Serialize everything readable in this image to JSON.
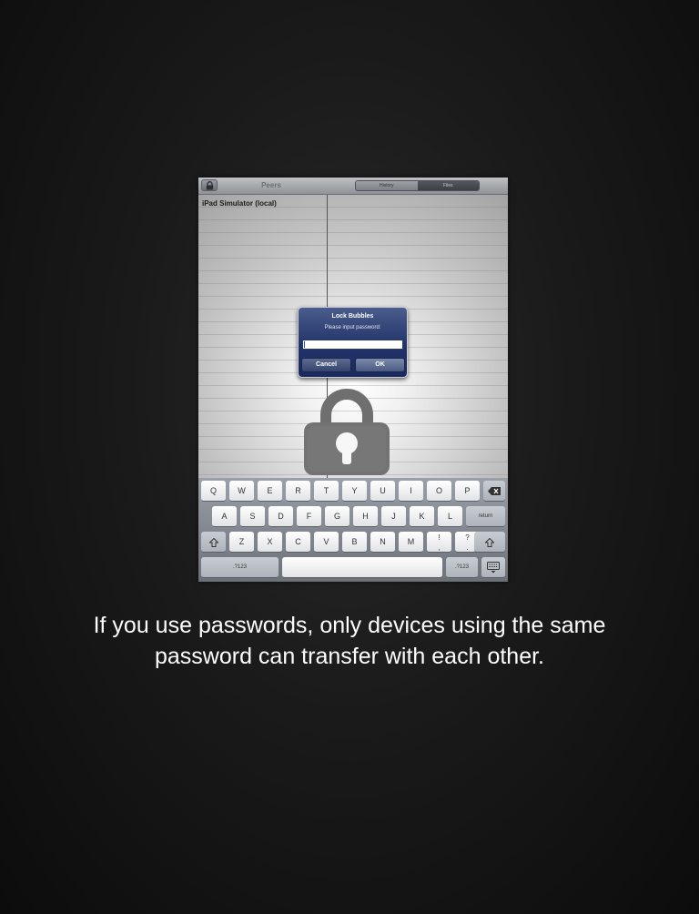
{
  "toolbar": {
    "title": "Peers",
    "lock_icon": "lock-icon",
    "segments": [
      "History",
      "Files"
    ],
    "selected_segment": "Files"
  },
  "peers": [
    "iPad Simulator (local)"
  ],
  "alert": {
    "title": "Lock Bubbles",
    "message": "Please input password:",
    "input_value": "",
    "cancel_label": "Cancel",
    "ok_label": "OK"
  },
  "keyboard": {
    "row1": [
      "Q",
      "W",
      "E",
      "R",
      "T",
      "Y",
      "U",
      "I",
      "O",
      "P"
    ],
    "row2": [
      "A",
      "S",
      "D",
      "F",
      "G",
      "H",
      "J",
      "K",
      "L"
    ],
    "return_label": "return",
    "row3": [
      "Z",
      "X",
      "C",
      "V",
      "B",
      "N",
      "M"
    ],
    "row3_punct1": [
      "!",
      ","
    ],
    "row3_punct2": [
      "?",
      "."
    ],
    "numbers_label": ".?123",
    "numbers_label_right": ".?123",
    "backspace_icon": "backspace-icon",
    "shift_icon": "shift-icon",
    "hide_keyboard_icon": "keyboard-hide-icon"
  },
  "caption": {
    "line1": "If you use passwords, only devices using the same",
    "line2": "password can transfer with each other."
  },
  "colors": {
    "alert_blue": "#22336a",
    "background": "#161616"
  }
}
